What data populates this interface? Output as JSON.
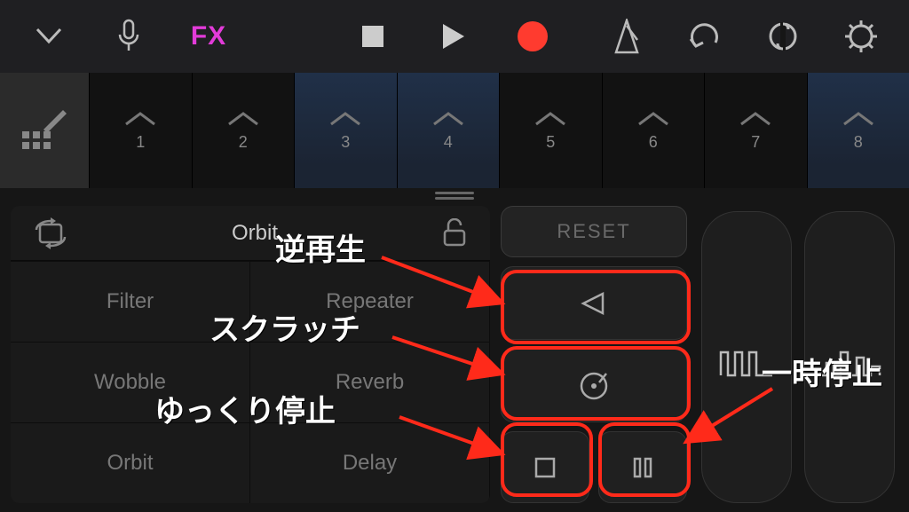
{
  "toolbar": {
    "fx_label": "FX"
  },
  "tracks": {
    "numbers": [
      "1",
      "2",
      "3",
      "4",
      "5",
      "6",
      "7",
      "8"
    ],
    "highlighted": [
      3,
      4,
      8
    ]
  },
  "fxbox": {
    "title": "Orbit",
    "items": [
      "Filter",
      "Repeater",
      "Wobble",
      "Reverb",
      "Orbit",
      "Delay"
    ]
  },
  "buttons": {
    "reset": "RESET"
  },
  "annotations": {
    "reverse": "逆再生",
    "scratch": "スクラッチ",
    "slowstop": "ゆっくり停止",
    "pause": "一時停止"
  }
}
